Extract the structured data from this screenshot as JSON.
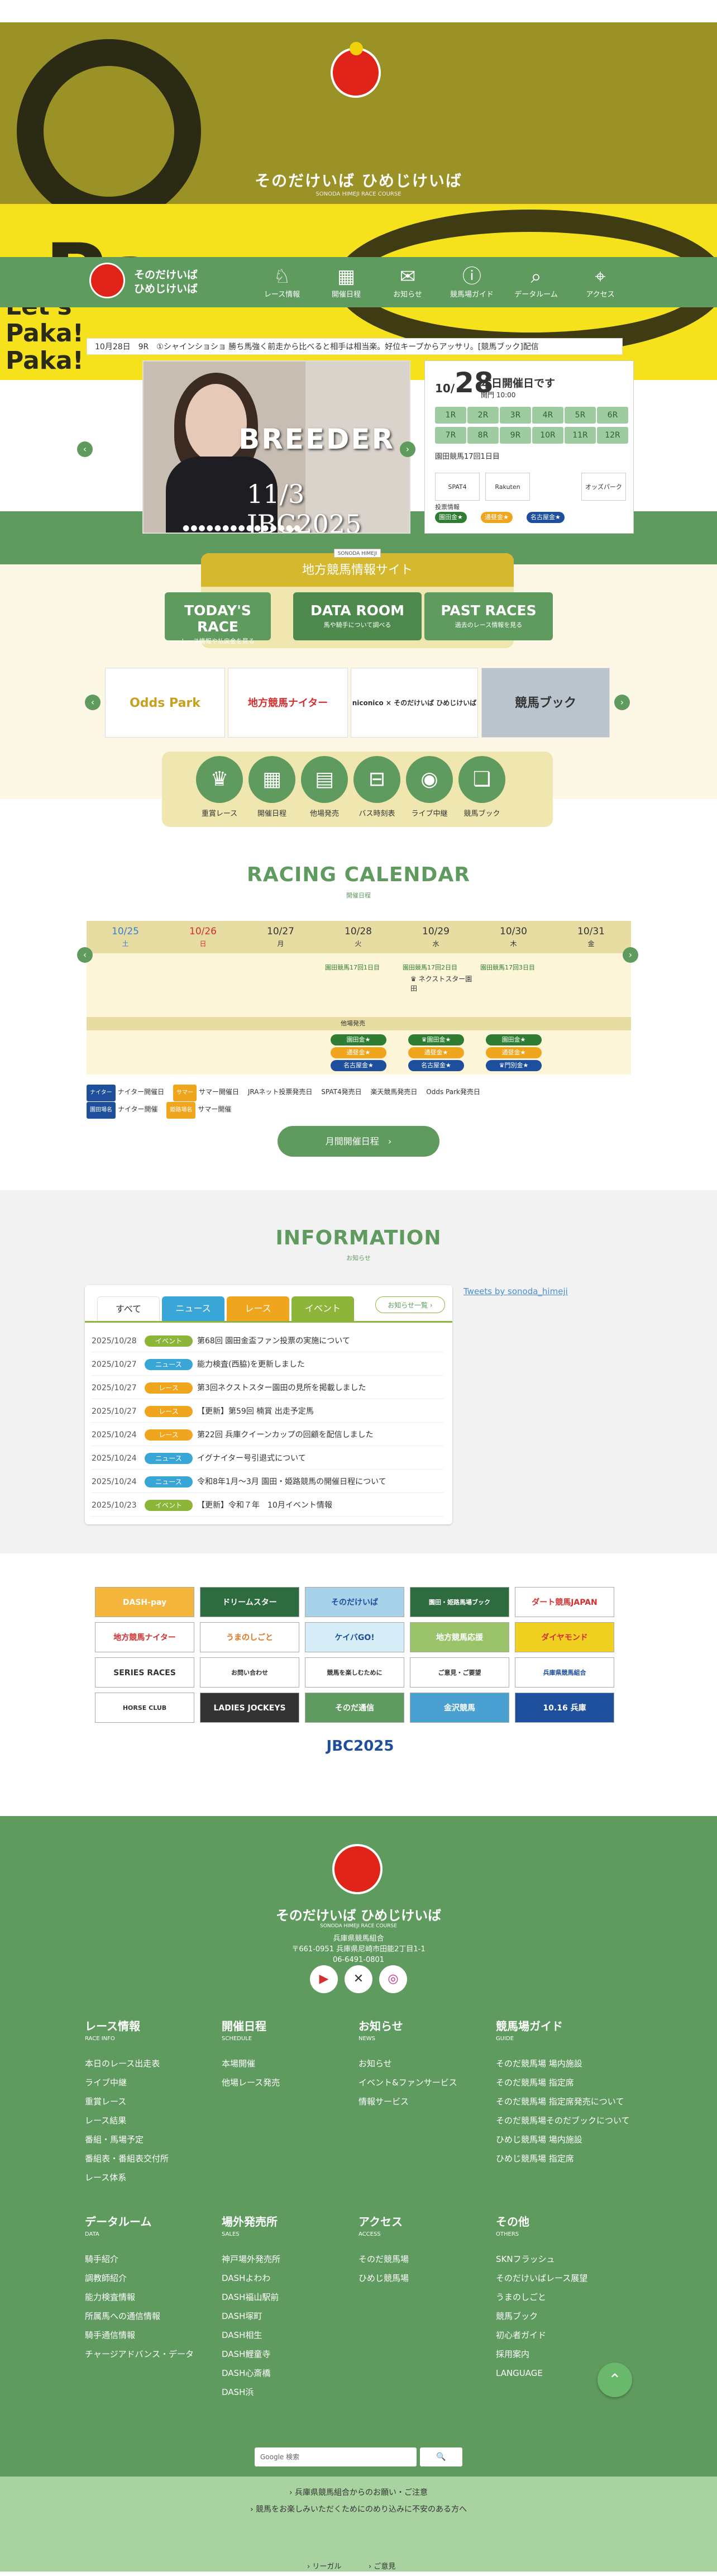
{
  "hero": {
    "brand": "そのだけいば ひめじけいば",
    "brand_en": "SONODA HIMEJI RACE COURSE",
    "mascot_text": "SONODA HIMEJI",
    "overlay_text": "Let's Paka! Paka!"
  },
  "nav": {
    "brand_line1": "そのだけいば",
    "brand_line2": "ひめじけいば",
    "items": [
      {
        "label": "レース情報",
        "icon": "horse-icon",
        "glyph": "♘"
      },
      {
        "label": "開催日程",
        "icon": "calendar-icon",
        "glyph": "▦"
      },
      {
        "label": "お知らせ",
        "icon": "speech-icon",
        "glyph": "✉"
      },
      {
        "label": "競馬場ガイド",
        "icon": "info-icon",
        "glyph": "ⓘ"
      },
      {
        "label": "データルーム",
        "icon": "search-icon",
        "glyph": "⌕"
      },
      {
        "label": "アクセス",
        "icon": "map-icon",
        "glyph": "⌖"
      }
    ]
  },
  "ticker": "10月28日　9R　①シャインショショ 勝ち馬強く前走から比べると相手は相当楽。好位キープからアッサリ。[競馬ブック]配信",
  "slider": {
    "title": "BREEDER",
    "subtitle": "JBC2025",
    "date": "11/3",
    "dots": "●●●●●●●●●●●●●●●"
  },
  "today": {
    "month": "10/",
    "day": "28",
    "title": "本日開催日です",
    "open": "開門 10:00",
    "races": [
      "1R",
      "2R",
      "3R",
      "4R",
      "5R",
      "6R",
      "7R",
      "8R",
      "9R",
      "10R",
      "11R",
      "12R"
    ],
    "meeting": "園田競馬17回1日目",
    "vote_label": "投票情報",
    "tags": [
      "園田金★",
      "通昼金★",
      "名古屋金★"
    ],
    "sponsors": [
      "SPAT4",
      "Rakuten",
      "オッズパーク"
    ]
  },
  "portal": {
    "badge": "SONODA HIMEJI",
    "title": "地方競馬情報サイト",
    "buttons": [
      {
        "title": "TODAY'S RACE",
        "sub": "レース情報や払戻金を見る"
      },
      {
        "title": "DATA ROOM",
        "sub": "馬や騎手について調べる"
      },
      {
        "title": "PAST RACES",
        "sub": "過去のレース情報を見る"
      }
    ]
  },
  "banners": [
    "Odds Park",
    "地方競馬ナイター",
    "niconico × そのだけいば ひめじけいば",
    "競馬ブック"
  ],
  "quick": [
    {
      "label": "重賞レース",
      "icon": "trophy-icon",
      "glyph": "♛"
    },
    {
      "label": "開催日程",
      "icon": "calendar-icon",
      "glyph": "▦"
    },
    {
      "label": "他場発売",
      "icon": "ticket-icon",
      "glyph": "▤"
    },
    {
      "label": "バス時刻表",
      "icon": "bus-icon",
      "glyph": "⊟"
    },
    {
      "label": "ライブ中継",
      "icon": "camera-icon",
      "glyph": "◉"
    },
    {
      "label": "競馬ブック",
      "icon": "book-icon",
      "glyph": "❏"
    }
  ],
  "calendar": {
    "title": "RACING CALENDAR",
    "sub": "開催日程",
    "days": [
      {
        "date": "10/25",
        "dow": "土",
        "color": "#3b7fd1"
      },
      {
        "date": "10/26",
        "dow": "日",
        "color": "#d32f2f"
      },
      {
        "date": "10/27",
        "dow": "月",
        "color": "#333333"
      },
      {
        "date": "10/28",
        "dow": "火",
        "color": "#333333"
      },
      {
        "date": "10/29",
        "dow": "水",
        "color": "#333333"
      },
      {
        "date": "10/30",
        "dow": "木",
        "color": "#333333"
      },
      {
        "date": "10/31",
        "dow": "金",
        "color": "#333333"
      }
    ],
    "meet1": "園田競馬17回1日目",
    "meet2": "園田競馬17回2日目",
    "meet3": "園田競馬17回3日目",
    "grade": "♛ ネクストスター園田",
    "other": "他場発売",
    "tag_a": "園田金★",
    "tag_b": "通昼金★",
    "tag_c": "名古屋金★",
    "tag_d": "♛園田金★",
    "tag_e": "♛門別金★",
    "legend1": "ナイター開催日",
    "legend2": "サマー開催日",
    "legend3": "JRAネット投票発売日",
    "legend4": "SPAT4発売日",
    "legend5": "楽天競馬発売日",
    "legend6": "Odds Park発売日",
    "legend7": "ナイター開催",
    "legend8": "サマー開催",
    "leg_tag1": "ナイター",
    "leg_tag2": "サマー",
    "leg_tag3": "園田場名",
    "leg_tag4": "姫路場名",
    "button": "月間開催日程"
  },
  "info": {
    "title": "INFORMATION",
    "sub": "お知らせ",
    "tabs": [
      "すべて",
      "ニュース",
      "レース",
      "イベント"
    ],
    "search": "お知らせ一覧",
    "twitter": "Tweets by sonoda_himeji",
    "rows": [
      {
        "date": "2025/10/28",
        "type": "イベント",
        "color": "#8cb53a",
        "text": "第68回 園田金盃ファン投票の実施について"
      },
      {
        "date": "2025/10/27",
        "type": "ニュース",
        "color": "#3aa6d8",
        "text": "能力検査(西脇)を更新しました"
      },
      {
        "date": "2025/10/27",
        "type": "レース",
        "color": "#f0a51e",
        "text": "第3回ネクストスター園田の見所を掲載しました"
      },
      {
        "date": "2025/10/27",
        "type": "レース",
        "color": "#f0a51e",
        "text": "【更新】第59回 楠賞 出走予定馬"
      },
      {
        "date": "2025/10/24",
        "type": "レース",
        "color": "#f0a51e",
        "text": "第22回 兵庫クイーンカップの回顧を配信しました"
      },
      {
        "date": "2025/10/24",
        "type": "ニュース",
        "color": "#3aa6d8",
        "text": "イグナイター号引退式について"
      },
      {
        "date": "2025/10/24",
        "type": "ニュース",
        "color": "#3aa6d8",
        "text": "令和8年1月〜3月 園田・姫路競馬の開催日程について"
      },
      {
        "date": "2025/10/23",
        "type": "イベント",
        "color": "#8cb53a",
        "text": "【更新】令和７年　10月イベント情報"
      }
    ]
  },
  "adbanners": [
    "DASH-pay",
    "ドリームスター",
    "そのだけいば",
    "園田・姫路馬場ブック",
    "ダート競馬JAPAN",
    "地方競馬ナイター",
    "うまのしごと",
    "ケイバGO!",
    "地方競馬応援",
    "ダイヤモンド",
    "SERIES RACES",
    "お問い合わせ",
    "競馬を楽しむために",
    "ご意見・ご要望",
    "兵庫県競馬組合",
    "HORSE CLUB",
    "LADIES JOCKEYS",
    "そのだ通信",
    "金沢競馬",
    "10.16 兵庫"
  ],
  "jbc": "JBC2025",
  "footer": {
    "brand": "そのだけいば ひめじけいば",
    "brand_en": "SONODA HIMEJI RACE COURSE",
    "org": "兵庫県競馬組合",
    "address": "〒661-0951 兵庫県尼崎市田能2丁目1-1",
    "tel": "06-6491-0801",
    "cols": [
      {
        "title": "レース情報",
        "en": "RACE INFO",
        "items": [
          "本日のレース出走表",
          "ライブ中継",
          "重賞レース",
          "レース結果",
          "番組・馬場予定",
          "番組表・番組表交付所",
          "レース体系"
        ]
      },
      {
        "title": "開催日程",
        "en": "SCHEDULE",
        "items": [
          "本場開催",
          "他場レース発売"
        ]
      },
      {
        "title": "お知らせ",
        "en": "NEWS",
        "items": [
          "お知らせ",
          "イベント&ファンサービス",
          "情報サービス"
        ]
      },
      {
        "title": "競馬場ガイド",
        "en": "GUIDE",
        "items": [
          "そのだ競馬場 場内施設",
          "そのだ競馬場 指定席",
          "そのだ競馬場 指定席発売について",
          "そのだ競馬場そのだブックについて",
          "ひめじ競馬場 場内施設",
          "ひめじ競馬場 指定席"
        ]
      },
      {
        "title": "データルーム",
        "en": "DATA",
        "items": [
          "騎手紹介",
          "調教師紹介",
          "能力検査情報",
          "所属馬への通信情報",
          "騎手通信情報",
          "チャージアドバンス・データ"
        ]
      },
      {
        "title": "場外発売所",
        "en": "SALES",
        "items": [
          "神戸場外発売所",
          "DASHよわわ",
          "DASH福山駅前",
          "DASH塚町",
          "DASH相生",
          "DASH鯉童寺",
          "DASH心斎橋",
          "DASH浜"
        ]
      },
      {
        "title": "アクセス",
        "en": "ACCESS",
        "items": [
          "そのだ競馬場",
          "ひめじ競馬場"
        ]
      },
      {
        "title": "その他",
        "en": "OTHERS",
        "items": [
          "SKNフラッシュ",
          "そのだけいばレース展望",
          "うまのしごと",
          "競馬ブック",
          "初心者ガイド",
          "採用案内",
          "LANGUAGE"
        ]
      }
    ],
    "search_label": "Google 検索",
    "search_btn": "🔍",
    "links": [
      "兵庫県競馬組合からのお願い・ご注意",
      "競馬をお楽しみいただくためにのめり込みに不安のある方へ"
    ],
    "bottom": [
      "リーガル",
      "ご意見"
    ]
  }
}
